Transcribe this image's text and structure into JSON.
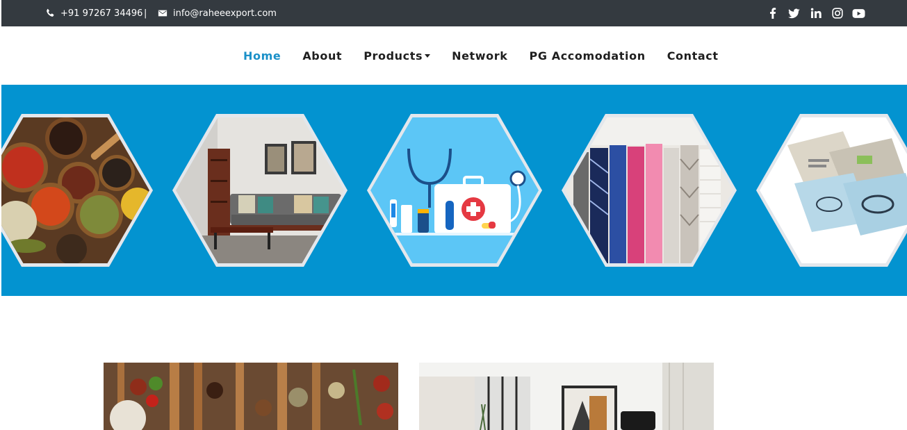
{
  "topbar": {
    "phone": "+91 97267 34496",
    "separator": "|",
    "email": "info@raheeexport.com",
    "social": [
      {
        "icon": "facebook-icon",
        "glyph": "f"
      },
      {
        "icon": "twitter-icon",
        "glyph": "t"
      },
      {
        "icon": "linkedin-icon",
        "glyph": "in"
      },
      {
        "icon": "instagram-icon",
        "glyph": "ig"
      },
      {
        "icon": "youtube-icon",
        "glyph": "yt"
      }
    ]
  },
  "nav": {
    "items": [
      {
        "label": "Home",
        "active": true
      },
      {
        "label": "About"
      },
      {
        "label": "Products",
        "dropdown": true
      },
      {
        "label": "Network"
      },
      {
        "label": "PG Accomodation"
      },
      {
        "label": "Contact"
      }
    ]
  },
  "hero": {
    "images": [
      "spices-image",
      "furniture-image",
      "medical-image",
      "textile-fabrics-image",
      "packaging-image"
    ]
  },
  "colors": {
    "topbar": "#343a40",
    "accent": "#1b90c8",
    "band": "#0393d0"
  }
}
